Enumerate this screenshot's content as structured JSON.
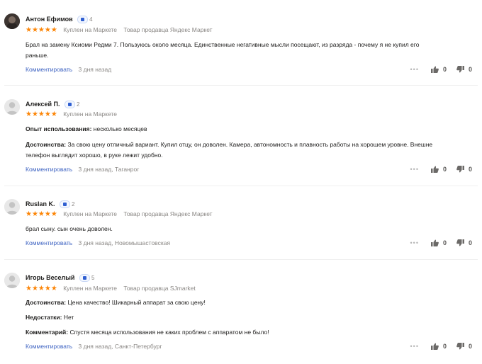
{
  "reviews": [
    {
      "author": "Антон Ефимов",
      "badge_count": "4",
      "rating_stars": "★★★★★",
      "rating": 5,
      "purchase": "Куплен на Маркете",
      "seller": "Товар продавца Яндекс Маркет",
      "lines": [
        "Брал на замену Ксиоми Редми 7. Пользуюсь около месяца. Единственные негативные мысли посещают, из разряда - почему я не купил его",
        "раньше."
      ],
      "comment_label": "Комментировать",
      "date": "3 дня назад",
      "likes": "0",
      "dislikes": "0"
    },
    {
      "author": "Алексей П.",
      "badge_count": "2",
      "rating_stars": "★★★★★",
      "rating": 5,
      "purchase": "Куплен на Маркете",
      "experience_label": "Опыт использования:",
      "experience_value": "несколько месяцев",
      "pros_label": "Достоинства:",
      "pros_value": "За свою цену отличный вариант. Купил отцу, он доволен. Камера, автономность и плавность работы на хорошем уровне. Внешне",
      "pros_value_2": "телефон выглядит хорошо, в руке лежит удобно.",
      "comment_label": "Комментировать",
      "date": "3 дня назад, Таганрог",
      "likes": "0",
      "dislikes": "0"
    },
    {
      "author": "Ruslan K.",
      "badge_count": "2",
      "rating_stars": "★★★★★",
      "rating": 5,
      "purchase": "Куплен на Маркете",
      "seller": "Товар продавца Яндекс Маркет",
      "text": "брал сыну. сын очень доволен.",
      "comment_label": "Комментировать",
      "date": "3 дня назад, Новомышастовская",
      "likes": "0",
      "dislikes": "0"
    },
    {
      "author": "Игорь Веселый",
      "badge_count": "5",
      "rating_stars": "★★★★★",
      "rating": 5,
      "purchase": "Куплен на Маркете",
      "seller": "Товар продавца SJmarket",
      "pros_label": "Достоинства:",
      "pros_value": "Цена качество! Шикарный аппарат за свою цену!",
      "cons_label": "Недостатки:",
      "cons_value": "Нет",
      "comments_label": "Комментарий:",
      "comments_value": "Спустя месяца использования не каких проблем с аппаратом не было!",
      "comment_label": "Комментировать",
      "date": "3 дня назад, Санкт-Петербург",
      "likes": "0",
      "dislikes": "0"
    }
  ],
  "more_dots": "•••",
  "icons": {
    "like": "thumb-up-icon",
    "dislike": "thumb-down-icon",
    "more": "more-dots-icon",
    "badge": "verified-badge-icon",
    "avatar": "user-avatar-icon"
  },
  "colors": {
    "star": "#fc8507",
    "link": "#3e63c2",
    "muted": "#8a8784"
  }
}
